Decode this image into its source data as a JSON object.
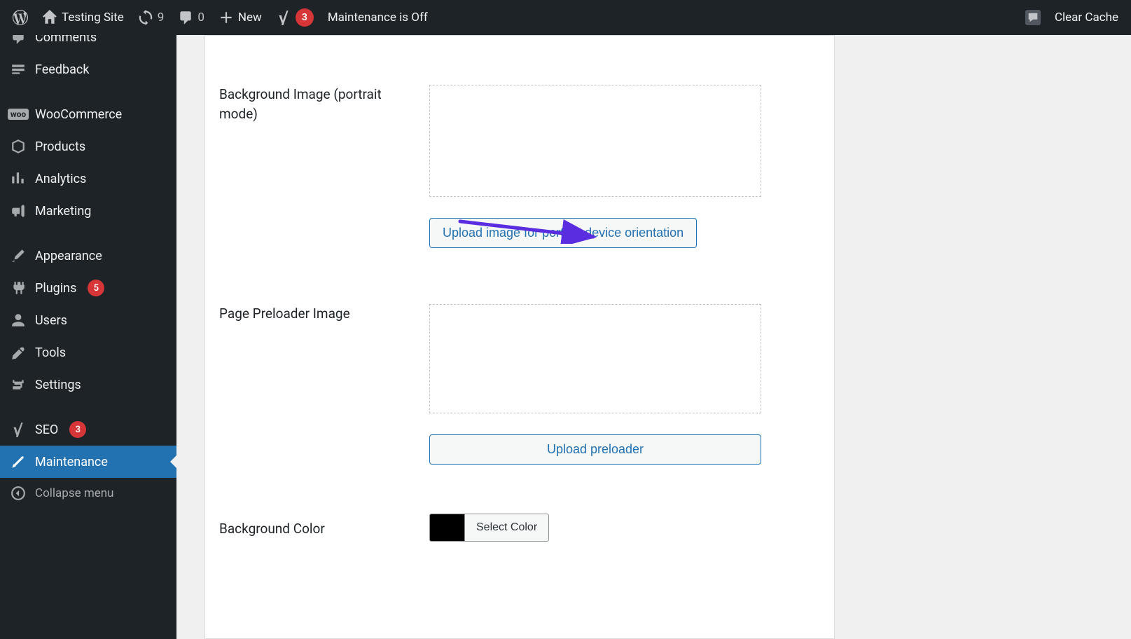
{
  "adminbar": {
    "site_name": "Testing Site",
    "updates_count": "9",
    "comments_count": "0",
    "new_label": "New",
    "yoast_count": "3",
    "maintenance_label": "Maintenance is Off",
    "clear_cache_label": "Clear Cache"
  },
  "sidebar": {
    "items": [
      {
        "label": "Comments"
      },
      {
        "label": "Feedback"
      },
      {
        "label": "WooCommerce"
      },
      {
        "label": "Products"
      },
      {
        "label": "Analytics"
      },
      {
        "label": "Marketing"
      },
      {
        "label": "Appearance"
      },
      {
        "label": "Plugins",
        "badge": "5"
      },
      {
        "label": "Users"
      },
      {
        "label": "Tools"
      },
      {
        "label": "Settings"
      },
      {
        "label": "SEO",
        "badge": "3"
      },
      {
        "label": "Maintenance"
      }
    ],
    "collapse_label": "Collapse menu"
  },
  "form": {
    "bg_portrait_label": "Background Image (portrait mode)",
    "upload_portrait_btn": "Upload image for portrait device orientation",
    "preloader_label": "Page Preloader Image",
    "upload_preloader_btn": "Upload preloader",
    "bg_color_label": "Background Color",
    "select_color_btn": "Select Color",
    "bg_color_value": "#000000"
  }
}
